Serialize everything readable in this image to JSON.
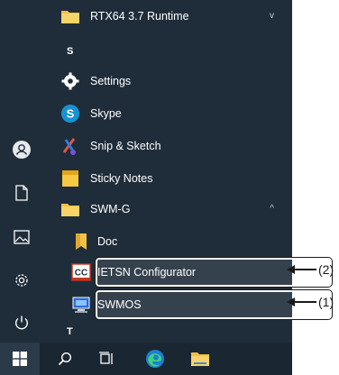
{
  "colors": {
    "menu_bg": "#1f2d3a",
    "taskbar_bg": "#1a2632",
    "folder_yellow": "#f1c044",
    "skype_blue": "#1593d4",
    "highlight_border": "#ffffff",
    "callout_color": "#1a1a1a"
  },
  "left_rail": {
    "icons": [
      "user-icon",
      "document-icon",
      "pictures-icon",
      "settings-gear-icon",
      "power-icon"
    ]
  },
  "app_list": {
    "top_folder": {
      "label": "RTX64 3.7 Runtime",
      "icon": "folder-icon",
      "chevron": "v"
    },
    "section_s": "S",
    "settings": {
      "label": "Settings",
      "icon": "gear-icon"
    },
    "skype": {
      "label": "Skype",
      "icon": "skype-icon",
      "icon_letter": "S"
    },
    "snip": {
      "label": "Snip & Sketch",
      "icon": "scissors-icon"
    },
    "sticky": {
      "label": "Sticky Notes",
      "icon": "sticky-note-icon"
    },
    "swm_folder": {
      "label": "SWM-G",
      "icon": "folder-icon",
      "chevron": "^"
    },
    "doc": {
      "label": "Doc",
      "icon": "doc-bookmark-icon"
    },
    "ietsn": {
      "label": "IETSN Configurator",
      "icon": "ietsn-app-icon",
      "icon_letters": "CC"
    },
    "swmos": {
      "label": "SWMOS",
      "icon": "swmos-app-icon"
    },
    "section_t": "T"
  },
  "taskbar": {
    "icons": [
      "windows-start-icon",
      "search-icon",
      "task-view-icon",
      "edge-browser-icon",
      "file-explorer-icon"
    ]
  },
  "callouts": {
    "ietsn": "(2)",
    "swmos": "(1)"
  }
}
